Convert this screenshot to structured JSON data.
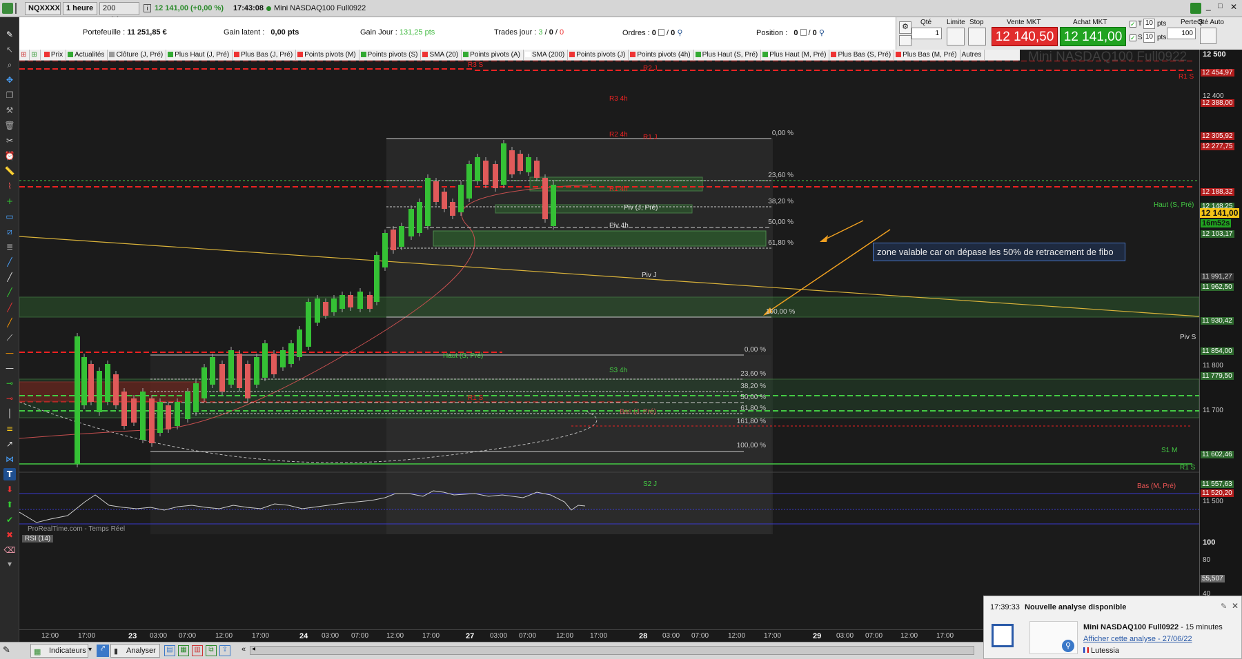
{
  "topbar": {
    "symbol": "NQXXXX",
    "timeframe": "1 heure",
    "units": "200 unités",
    "last_price": "12 141,00 (+0,00 %)",
    "time": "17:43:08",
    "instrument": "Mini NASDAQ100 Full0922"
  },
  "infobar": {
    "portefeuille_label": "Portefeuille :",
    "portefeuille_value": "11 251,85 €",
    "gain_latent_label": "Gain latent :",
    "gain_latent_value": "0,00 pts",
    "gain_jour_label": "Gain Jour :",
    "gain_jour_value": "131,25 pts",
    "trades_label": "Trades jour :",
    "trades_a": "3",
    "trades_b": "0",
    "trades_c": "0",
    "ordres_label": "Ordres :",
    "ordres_a": "0",
    "ordres_b": "0",
    "position_label": "Position :",
    "position_a": "0",
    "position_b": "0"
  },
  "orderpanel": {
    "qte_label": "Qté",
    "qte_value": "1",
    "limite_label": "Limite",
    "stop_label": "Stop",
    "vente_label": "Vente MKT",
    "vente_price": "12 140,50",
    "achat_label": "Achat MKT",
    "achat_price": "12 141,00",
    "t_label": "T",
    "s_label": "S",
    "t_pts": "10",
    "s_pts": "10",
    "pts_unit": "pts",
    "perte_label": "Perte $",
    "perte_value": "100",
    "qte_auto_label": "Qté Auto"
  },
  "indicators": [
    {
      "label": "Prix",
      "color": "#e33"
    },
    {
      "label": "Actualités",
      "color": "#3a3"
    },
    {
      "label": "Clôture (J, Pré)",
      "color": "#999"
    },
    {
      "label": "Plus Haut (J, Pré)",
      "color": "#3a3"
    },
    {
      "label": "Plus Bas (J, Pré)",
      "color": "#e33"
    },
    {
      "label": "Points pivots (M)",
      "color": "#e33"
    },
    {
      "label": "Points pivots (S)",
      "color": "#3a3"
    },
    {
      "label": "SMA (20)",
      "color": "#e33"
    },
    {
      "label": "Points pivots (A)",
      "color": "#3a3"
    },
    {
      "label": "SMA (200)",
      "color": "#fff"
    },
    {
      "label": "Points pivots (J)",
      "color": "#e33"
    },
    {
      "label": "Points pivots (4h)",
      "color": "#e33"
    },
    {
      "label": "Plus Haut (S, Pré)",
      "color": "#3a3"
    },
    {
      "label": "Plus Haut (M, Pré)",
      "color": "#3a3"
    },
    {
      "label": "Plus Bas (S, Pré)",
      "color": "#e33"
    },
    {
      "label": "Plus Bas (M, Pré)",
      "color": "#e33"
    },
    {
      "label": "Autres",
      "color": ""
    }
  ],
  "chart": {
    "watermark": "Mini NASDAQ100 Full0922",
    "rsi_label": "RSI (14)",
    "source_label": "ProRealTime.com - Temps Réel",
    "annotation": "zone valable car on dépase les 50% de retracement de fibo",
    "fib_upper": [
      "0,00 %",
      "23,60 %",
      "38,20 %",
      "50,00 %",
      "61,80 %",
      "100,00 %"
    ],
    "fib_lower": [
      "0,00 %",
      "23,60 %",
      "38,20 %",
      "50,00 %",
      "61,80 %",
      "161,80 %",
      "100,00 %"
    ],
    "levels": {
      "r3s": "R3 S",
      "r2j": "R2 J",
      "r1s": "R1 S",
      "r3_4h": "R3 4h",
      "r2_4h": "R2 4h",
      "r1j": "R1 J",
      "r1_4h": "R1 4h",
      "piv_j_pre": "Piv (J, Pré)",
      "piv_4h": "Piv 4h",
      "piv_j": "Piv J",
      "haut_s_pre": "Haut (S, Pré)",
      "piv_s": "Piv S",
      "s3_4h": "S3 4h",
      "r1_s_low": "R1 S",
      "bas_j_pre": "Bas (J, Pré)",
      "s1m": "S1 M",
      "bas_m_pre": "Bas (M, Pré)",
      "s2j": "S2 J",
      "r1s_right": "R1 S",
      "haut_s_pre_right": "Haut (S, Pré)"
    }
  },
  "yaxis": {
    "top": "12 500",
    "p1": "12 454,97",
    "p2": "12 400",
    "p3": "12 388,00",
    "p4": "12 305,92",
    "p5": "12 277,75",
    "p6": "12 188,32",
    "p7": "12 148,25",
    "current": "12 141,00",
    "timer": "16m52s",
    "p8": "12 103,17",
    "p9": "11 991,27",
    "p10": "11 962,50",
    "p11": "11 930,42",
    "p12": "11 854,00",
    "p13": "11 800",
    "p14": "11 779,50",
    "p15": "11 700",
    "p16": "11 602,46",
    "p17": "11 557,63",
    "p18": "11 520,20",
    "p19": "11 500",
    "rsi_100": "100",
    "rsi_80": "80",
    "rsi_val": "55,507",
    "rsi_40": "40"
  },
  "xaxis": [
    "12:00",
    "17:00",
    "23",
    "03:00",
    "07:00",
    "12:00",
    "17:00",
    "24",
    "03:00",
    "07:00",
    "12:00",
    "17:00",
    "27",
    "03:00",
    "07:00",
    "12:00",
    "17:00",
    "28",
    "03:00",
    "07:00",
    "12:00",
    "17:00",
    "29",
    "03:00",
    "07:00",
    "12:00",
    "17:00"
  ],
  "bottom": {
    "indicateurs": "Indicateurs",
    "analyser": "Analyser"
  },
  "notification": {
    "time": "17:39:33",
    "title": "Nouvelle analyse disponible",
    "subject": "Mini NASDAQ100 Full0922",
    "interval": "- 15 minutes",
    "link": "Afficher cette analyse - 27/06/22",
    "author": "Lutessia"
  }
}
